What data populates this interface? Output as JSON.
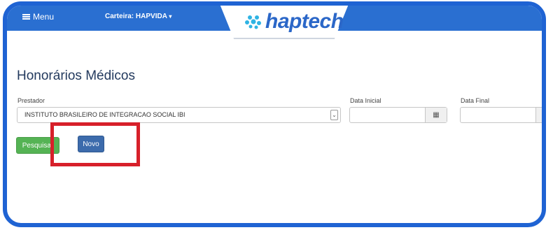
{
  "header": {
    "menu_label": "Menu",
    "carteira_label": "Carteira: HAPVIDA",
    "logo_text": "haptech",
    "logo_mark_color": "#2fb3e3"
  },
  "page": {
    "title": "Honorários Médicos"
  },
  "form": {
    "prestador_label": "Prestador",
    "prestador_value": "INSTITUTO BRASILEIRO DE INTEGRACAO SOCIAL IBI",
    "data_inicial_label": "Data Inicial",
    "data_inicial_value": "",
    "data_final_label": "Data Final",
    "data_final_value": ""
  },
  "actions": {
    "pesquisar_label": "Pesquisar",
    "novo_label": "Novo",
    "pesquisar_color": "#55b354",
    "novo_color": "#3c6bac"
  },
  "annotation": {
    "highlight_color": "#d7202a"
  }
}
